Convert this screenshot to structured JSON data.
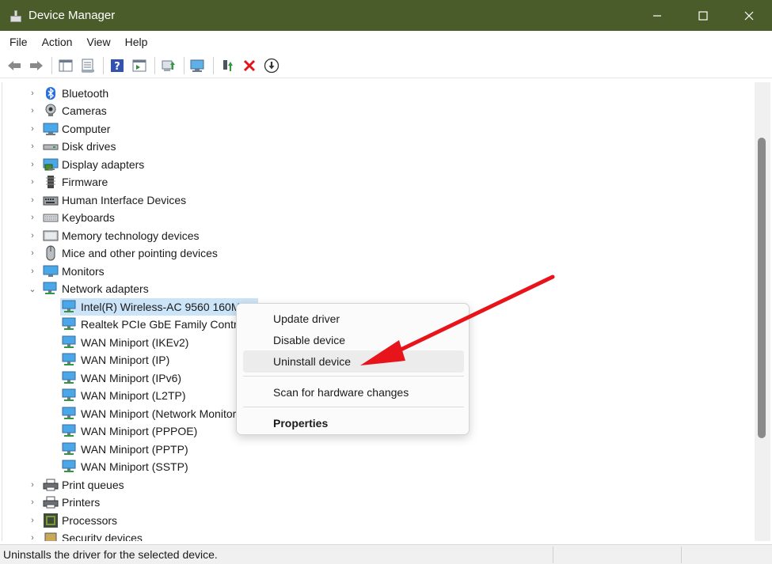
{
  "window": {
    "title": "Device Manager",
    "controls": {
      "minimize": "—",
      "maximize": "☐",
      "close": "✕"
    }
  },
  "menu": [
    "File",
    "Action",
    "View",
    "Help"
  ],
  "toolbar": [
    "back-arrow-icon",
    "forward-arrow-icon",
    "show-hide-console-tree-icon",
    "properties-icon",
    "help-icon",
    "action-pane-icon",
    "update-driver-icon",
    "scan-hardware-icon",
    "enable-device-icon",
    "uninstall-device-icon",
    "disable-device-icon"
  ],
  "tree": {
    "categories": [
      {
        "label": "Bluetooth",
        "icon": "bluetooth-icon",
        "expanded": false
      },
      {
        "label": "Cameras",
        "icon": "camera-icon",
        "expanded": false
      },
      {
        "label": "Computer",
        "icon": "computer-icon",
        "expanded": false
      },
      {
        "label": "Disk drives",
        "icon": "disk-drive-icon",
        "expanded": false
      },
      {
        "label": "Display adapters",
        "icon": "display-adapter-icon",
        "expanded": false
      },
      {
        "label": "Firmware",
        "icon": "firmware-icon",
        "expanded": false
      },
      {
        "label": "Human Interface Devices",
        "icon": "hid-icon",
        "expanded": false
      },
      {
        "label": "Keyboards",
        "icon": "keyboard-icon",
        "expanded": false
      },
      {
        "label": "Memory technology devices",
        "icon": "memory-device-icon",
        "expanded": false
      },
      {
        "label": "Mice and other pointing devices",
        "icon": "mouse-icon",
        "expanded": false
      },
      {
        "label": "Monitors",
        "icon": "monitor-icon",
        "expanded": false
      },
      {
        "label": "Network adapters",
        "icon": "network-adapter-icon",
        "expanded": true
      }
    ],
    "network_children": [
      "Intel(R) Wireless-AC 9560 160MHz",
      "Realtek PCIe GbE Family Controller",
      "WAN Miniport (IKEv2)",
      "WAN Miniport (IP)",
      "WAN Miniport (IPv6)",
      "WAN Miniport (L2TP)",
      "WAN Miniport (Network Monitor)",
      "WAN Miniport (PPPOE)",
      "WAN Miniport (PPTP)",
      "WAN Miniport (SSTP)"
    ],
    "after": [
      {
        "label": "Print queues",
        "icon": "print-queue-icon"
      },
      {
        "label": "Printers",
        "icon": "printer-icon"
      },
      {
        "label": "Processors",
        "icon": "processor-icon"
      },
      {
        "label": "Security devices",
        "icon": "security-device-icon"
      }
    ]
  },
  "context_menu": {
    "items": [
      "Update driver",
      "Disable device",
      "Uninstall device",
      "Scan for hardware changes",
      "Properties"
    ],
    "highlighted": "Uninstall device"
  },
  "annotation": {
    "color": "#e8141b"
  },
  "status_bar": {
    "text": "Uninstalls the driver for the selected device."
  },
  "colors": {
    "titlebar": "#4a5c2a",
    "selection": "#cce4f7",
    "arrow": "#e8141b"
  }
}
